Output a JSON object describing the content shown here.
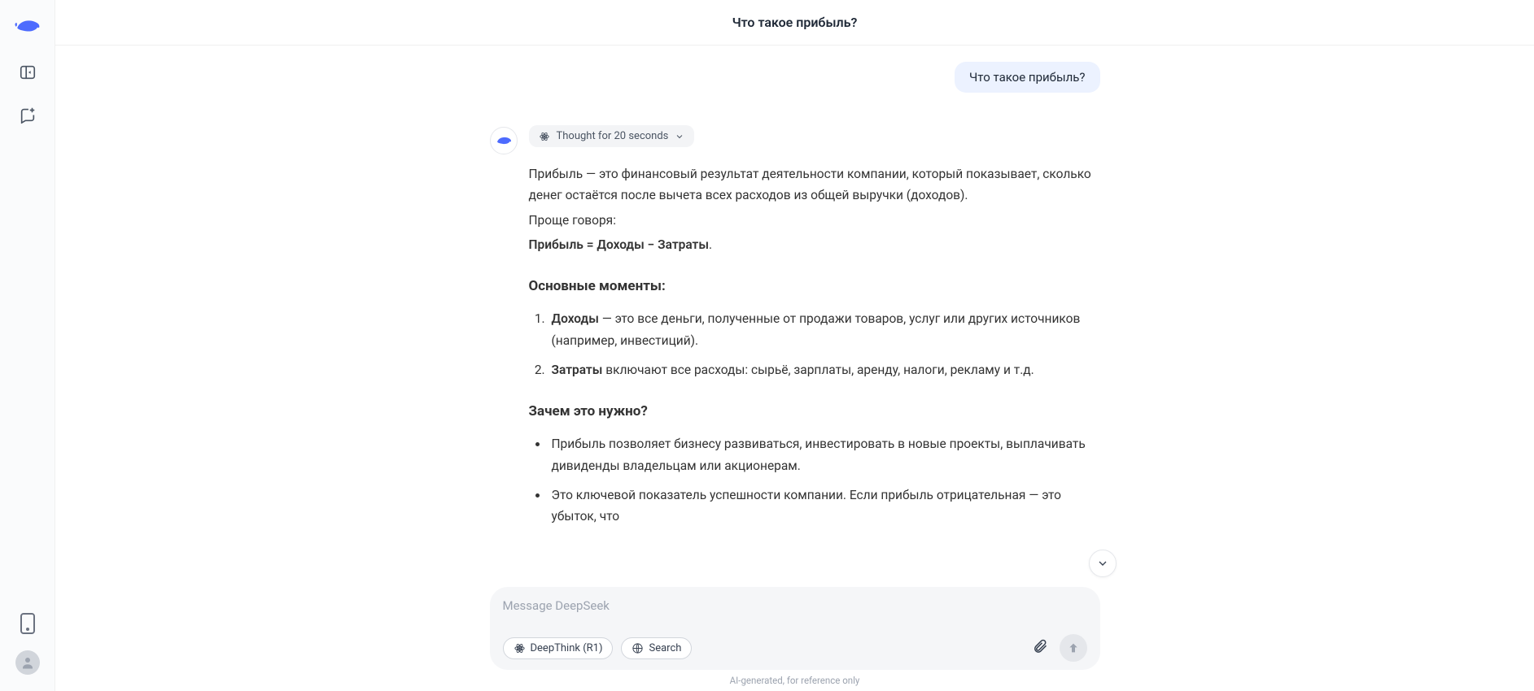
{
  "header": {
    "title": "Что такое прибыль?"
  },
  "sidebar": {
    "icons": [
      "logo",
      "toggle",
      "new-chat",
      "mobile",
      "profile"
    ]
  },
  "chat": {
    "user_message": "Что такое прибыль?",
    "thought_label": "Thought for 20 seconds",
    "paragraphs": {
      "p1": "Прибыль — это финансовый результат деятельности компании, который показывает, сколько денег остаётся после вычета всех расходов из общей выручки (доходов).",
      "p2": "Проще говоря:",
      "formula_bold": "Прибыль = Доходы − Затраты",
      "formula_tail": "."
    },
    "section1_title": "Основные моменты:",
    "ol": [
      {
        "bold": "Доходы",
        "rest": " — это все деньги, полученные от продажи товаров, услуг или других источников (например, инвестиций)."
      },
      {
        "bold": "Затраты",
        "rest": " включают все расходы: сырьё, зарплаты, аренду, налоги, рекламу и т.д."
      }
    ],
    "section2_title": "Зачем это нужно?",
    "ul": [
      "Прибыль позволяет бизнесу развиваться, инвестировать в новые проекты, выплачивать дивиденды владельцам или акционерам.",
      "Это ключевой показатель успешности компании. Если прибыль отрицательная — это убыток, что"
    ]
  },
  "composer": {
    "placeholder": "Message DeepSeek",
    "deepthink_label": "DeepThink (R1)",
    "search_label": "Search"
  },
  "footer": {
    "note": "AI-generated, for reference only"
  }
}
